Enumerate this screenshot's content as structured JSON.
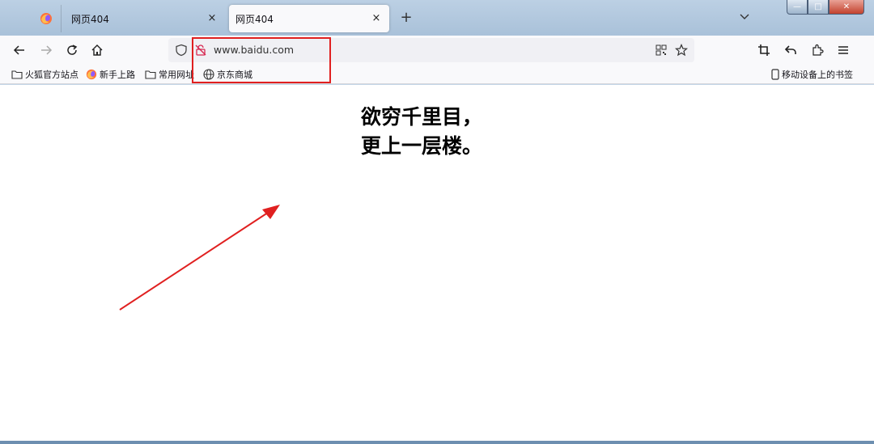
{
  "browser": {
    "tabs": [
      {
        "title": "网页404",
        "active": false
      },
      {
        "title": "网页404",
        "active": true
      }
    ],
    "close_glyph": "×",
    "newtab_glyph": "+",
    "url": "www.baidu.com",
    "accent_color": "#e02020"
  },
  "window_controls": {
    "minimize": "—",
    "maximize": "□",
    "close": "✕"
  },
  "bookmarks": {
    "items": [
      {
        "label": "火狐官方站点",
        "icon": "folder-icon"
      },
      {
        "label": "新手上路",
        "icon": "firefox-icon"
      },
      {
        "label": "常用网址",
        "icon": "folder-icon"
      },
      {
        "label": "京东商城",
        "icon": "globe-icon"
      }
    ],
    "mobile": "移动设备上的书签"
  },
  "page": {
    "line1": "欲穷千里目，",
    "line2": "更上一层楼。"
  }
}
